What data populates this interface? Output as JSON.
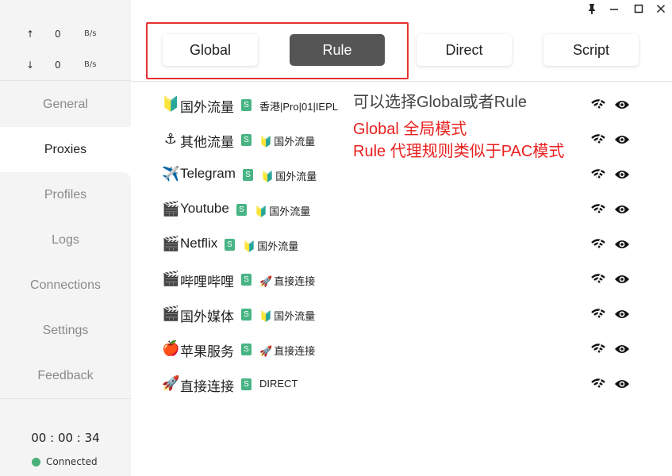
{
  "window": {
    "pin_icon": "pin-icon",
    "minimize_icon": "minimize-icon",
    "maximize_icon": "maximize-icon",
    "close_icon": "close-icon"
  },
  "traffic": {
    "up_arrow": "↑",
    "up_value": "0",
    "up_unit": "B/s",
    "down_arrow": "↓",
    "down_value": "0",
    "down_unit": "B/s"
  },
  "nav": {
    "items": [
      {
        "label": "General"
      },
      {
        "label": "Proxies"
      },
      {
        "label": "Profiles"
      },
      {
        "label": "Logs"
      },
      {
        "label": "Connections"
      },
      {
        "label": "Settings"
      },
      {
        "label": "Feedback"
      }
    ],
    "active": "Proxies"
  },
  "status": {
    "timer": "00 : 00 : 34",
    "text": "Connected",
    "color": "#4caf78"
  },
  "modes": {
    "items": [
      {
        "label": "Global"
      },
      {
        "label": "Rule"
      },
      {
        "label": "Direct"
      },
      {
        "label": "Script"
      }
    ],
    "active": "Rule",
    "highlight_color": "#e83030"
  },
  "proxies": [
    {
      "emoji": "🔰",
      "name": "国外流量",
      "badge": "S",
      "sel_emoji": "",
      "selected": "香港|Pro|01|IEPL"
    },
    {
      "emoji": "⚓",
      "name": "其他流量",
      "badge": "S",
      "sel_emoji": "🔰",
      "selected": "国外流量"
    },
    {
      "emoji": "✈️",
      "name": "Telegram",
      "badge": "S",
      "sel_emoji": "🔰",
      "selected": "国外流量"
    },
    {
      "emoji": "🎬",
      "name": "Youtube",
      "badge": "S",
      "sel_emoji": "🔰",
      "selected": "国外流量"
    },
    {
      "emoji": "🎬",
      "name": "Netflix",
      "badge": "S",
      "sel_emoji": "🔰",
      "selected": "国外流量"
    },
    {
      "emoji": "🎬",
      "name": "哔哩哔哩",
      "badge": "S",
      "sel_emoji": "🚀",
      "selected": "直接连接"
    },
    {
      "emoji": "🎬",
      "name": "国外媒体",
      "badge": "S",
      "sel_emoji": "🔰",
      "selected": "国外流量"
    },
    {
      "emoji": "🍎",
      "name": "苹果服务",
      "badge": "S",
      "sel_emoji": "🚀",
      "selected": "直接连接"
    },
    {
      "emoji": "🚀",
      "name": "直接连接",
      "badge": "S",
      "sel_emoji": "",
      "selected": "DIRECT"
    }
  ],
  "annotation": {
    "line1": "可以选择Global或者Rule",
    "line2": "Global 全局模式",
    "line3": "Rule 代理规则类似于PAC模式",
    "red": "#e8201f"
  }
}
